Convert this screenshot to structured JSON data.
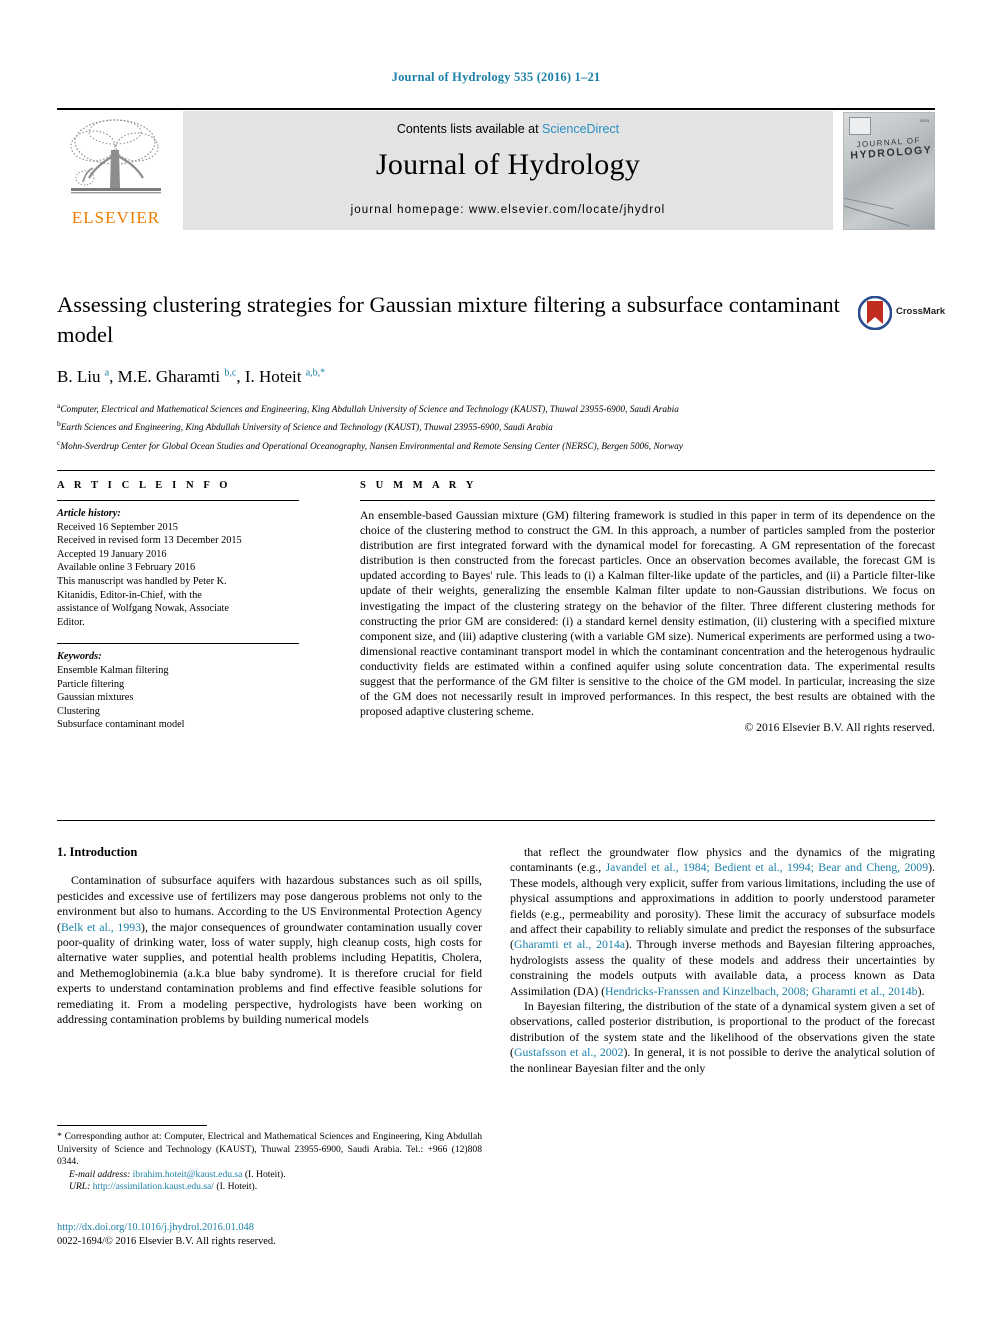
{
  "running_head": "Journal of Hydrology 535 (2016) 1–21",
  "masthead": {
    "contents_prefix": "Contents lists available at",
    "sciencedirect": "ScienceDirect",
    "journal_name": "Journal of Hydrology",
    "homepage": "journal homepage: www.elsevier.com/locate/jhydrol",
    "publisher_logo_text": "ELSEVIER",
    "cover_title_line1": "JOURNAL OF",
    "cover_title_line2": "HYDROLOGY",
    "accent_link_color": "#2a8fc4",
    "publisher_orange": "#f07c00"
  },
  "article": {
    "title": "Assessing clustering strategies for Gaussian mixture filtering a subsurface contaminant model",
    "authors_html": "B. Liu <sup>a</sup>, M.E. Gharamti <sup>b,c</sup>, I. Hoteit <sup>a,b,</sup><sup>*</sup>",
    "affiliations": [
      "Computer, Electrical and Mathematical Sciences and Engineering, King Abdullah University of Science and Technology (KAUST), Thuwal 23955-6900, Saudi Arabia",
      "Earth Sciences and Engineering, King Abdullah University of Science and Technology (KAUST), Thuwal 23955-6900, Saudi Arabia",
      "Mohn-Sverdrup Center for Global Ocean Studies and Operational Oceanography, Nansen Environmental and Remote Sensing Center (NERSC), Bergen 5006, Norway"
    ],
    "affil_markers": [
      "a",
      "b",
      "c"
    ],
    "crossmark_label": "CrossMark"
  },
  "sections": {
    "article_info_head": "A R T I C L E   I N F O",
    "summary_head": "S U M M A R Y"
  },
  "article_info": {
    "history_label": "Article history:",
    "history": [
      "Received 16 September 2015",
      "Received in revised form 13 December 2015",
      "Accepted 19 January 2016",
      "Available online 3 February 2016",
      "This manuscript was handled by Peter K.",
      "Kitanidis, Editor-in-Chief, with the",
      "assistance of Wolfgang Nowak, Associate",
      "Editor."
    ],
    "keywords_label": "Keywords:",
    "keywords": [
      "Ensemble Kalman filtering",
      "Particle filtering",
      "Gaussian mixtures",
      "Clustering",
      "Subsurface contaminant model"
    ]
  },
  "summary": {
    "abstract": "An ensemble-based Gaussian mixture (GM) filtering framework is studied in this paper in term of its dependence on the choice of the clustering method to construct the GM. In this approach, a number of particles sampled from the posterior distribution are first integrated forward with the dynamical model for forecasting. A GM representation of the forecast distribution is then constructed from the forecast particles. Once an observation becomes available, the forecast GM is updated according to Bayes' rule. This leads to (i) a Kalman filter-like update of the particles, and (ii) a Particle filter-like update of their weights, generalizing the ensemble Kalman filter update to non-Gaussian distributions. We focus on investigating the impact of the clustering strategy on the behavior of the filter. Three different clustering methods for constructing the prior GM are considered: (i) a standard kernel density estimation, (ii) clustering with a specified mixture component size, and (iii) adaptive clustering (with a variable GM size). Numerical experiments are performed using a two-dimensional reactive contaminant transport model in which the contaminant concentration and the heterogenous hydraulic conductivity fields are estimated within a confined aquifer using solute concentration data. The experimental results suggest that the performance of the GM filter is sensitive to the choice of the GM model. In particular, increasing the size of the GM does not necessarily result in improved performances. In this respect, the best results are obtained with the proposed adaptive clustering scheme.",
    "copyright": "© 2016 Elsevier B.V. All rights reserved."
  },
  "body": {
    "section_number_title": "1. Introduction",
    "left_paragraph_1_a": "Contamination of subsurface aquifers with hazardous substances such as oil spills, pesticides and excessive use of fertilizers may pose dangerous problems not only to the environment but also to humans. According to the US Environmental Protection Agency (",
    "left_cite_1": "Belk et al., 1993",
    "left_paragraph_1_b": "), the major consequences of groundwater contamination usually cover poor-quality of drinking water, loss of water supply, high cleanup costs, high costs for alternative water supplies, and potential health problems including Hepatitis, Cholera, and Methemoglobinemia (a.k.a blue baby syndrome). It is therefore crucial for field experts to understand contamination problems and find effective feasible solutions for remediating it. From a modeling perspective, hydrologists have been working on addressing contamination problems by building numerical models",
    "right_paragraph_1_a": "that reflect the groundwater flow physics and the dynamics of the migrating contaminants (e.g., ",
    "right_cite_1": "Javandel et al., 1984; Bedient et al., 1994; Bear and Cheng, 2009",
    "right_paragraph_1_b": "). These models, although very explicit, suffer from various limitations, including the use of physical assumptions and approximations in addition to poorly understood parameter fields (e.g., permeability and porosity). These limit the accuracy of subsurface models and affect their capability to reliably simulate and predict the responses of the subsurface (",
    "right_cite_2": "Gharamti et al., 2014a",
    "right_paragraph_1_c": "). Through inverse methods and Bayesian filtering approaches, hydrologists assess the quality of these models and address their uncertainties by constraining the models outputs with available data, a process known as Data Assimilation (DA) (",
    "right_cite_3": "Hendricks-Franssen and Kinzelbach, 2008; Gharamti et al., 2014b",
    "right_paragraph_1_d": ").",
    "right_paragraph_2_a": "In Bayesian filtering, the distribution of the state of a dynamical system given a set of observations, called posterior distribution, is proportional to the product of the forecast distribution of the system state and the likelihood of the observations given the state (",
    "right_cite_4": "Gustafsson et al., 2002",
    "right_paragraph_2_b": "). In general, it is not possible to derive the analytical solution of the nonlinear Bayesian filter and the only"
  },
  "footnote": {
    "marker": "*",
    "corresponding_text": "Corresponding author at: Computer, Electrical and Mathematical Sciences and Engineering, King Abdullah University of Science and Technology (KAUST), Thuwal 23955-6900, Saudi Arabia. Tel.: +966 (12)808 0344.",
    "email_label": "E-mail address:",
    "email": "ibrahim.hoteit@kaust.edu.sa",
    "email_owner": "(I. Hoteit).",
    "url_label": "URL:",
    "url": "http://assimilation.kaust.edu.sa/",
    "url_owner": "(I. Hoteit).",
    "doi": "http://dx.doi.org/10.1016/j.jhydrol.2016.01.048",
    "issn_line": "0022-1694/© 2016 Elsevier B.V. All rights reserved."
  }
}
